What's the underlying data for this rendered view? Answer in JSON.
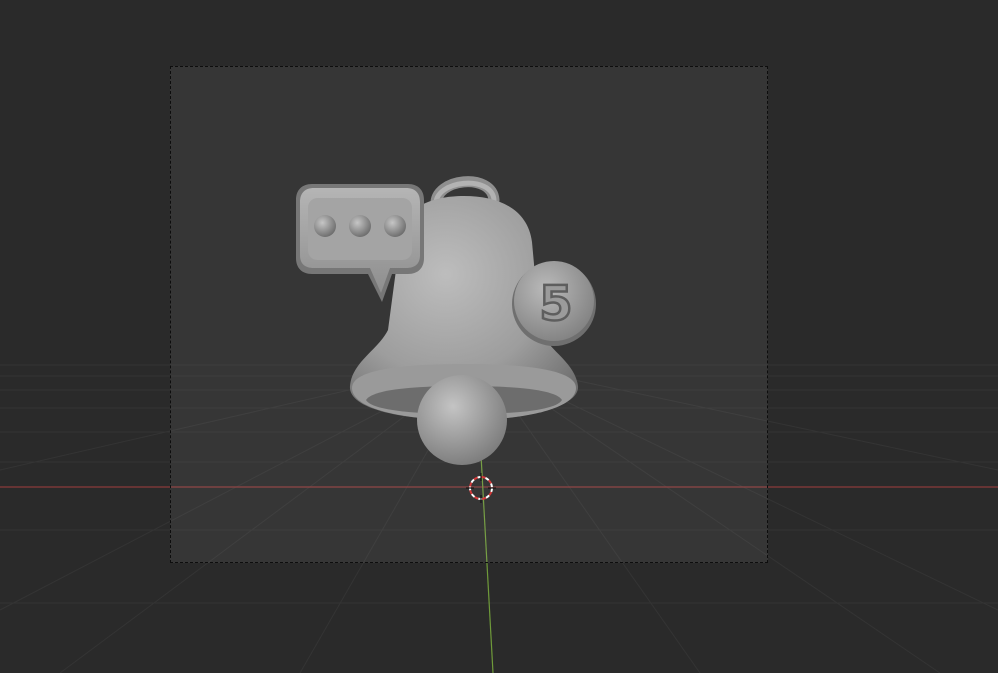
{
  "viewport": {
    "background": "#2a2a2a",
    "grid_color": "#3a3a3a",
    "x_axis_color": "#8a3b3b",
    "y_axis_color": "#6f9a3a",
    "frame_fill": "#353535"
  },
  "model": {
    "name": "notification-bell",
    "material_color": "#a9a9a9",
    "badge": {
      "number": "5"
    },
    "speech_bubble": {
      "dots": 3
    }
  },
  "icons": {
    "cursor": "3d-cursor-icon"
  }
}
